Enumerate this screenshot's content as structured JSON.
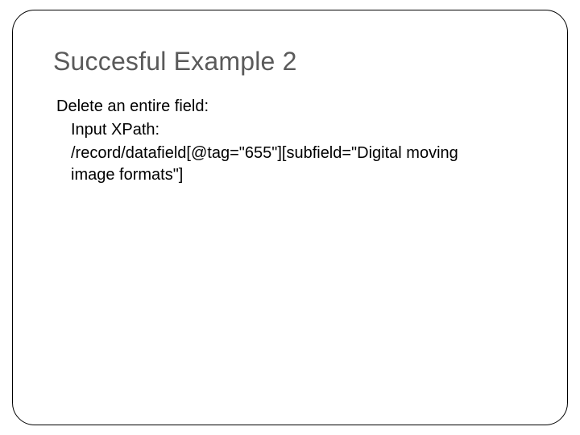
{
  "slide": {
    "title": "Succesful Example 2",
    "body": {
      "heading": "Delete an entire field:",
      "input_label": "Input XPath:",
      "xpath_value": "/record/datafield[@tag=\"655\"][subfield=\"Digital moving image formats\"]"
    }
  }
}
